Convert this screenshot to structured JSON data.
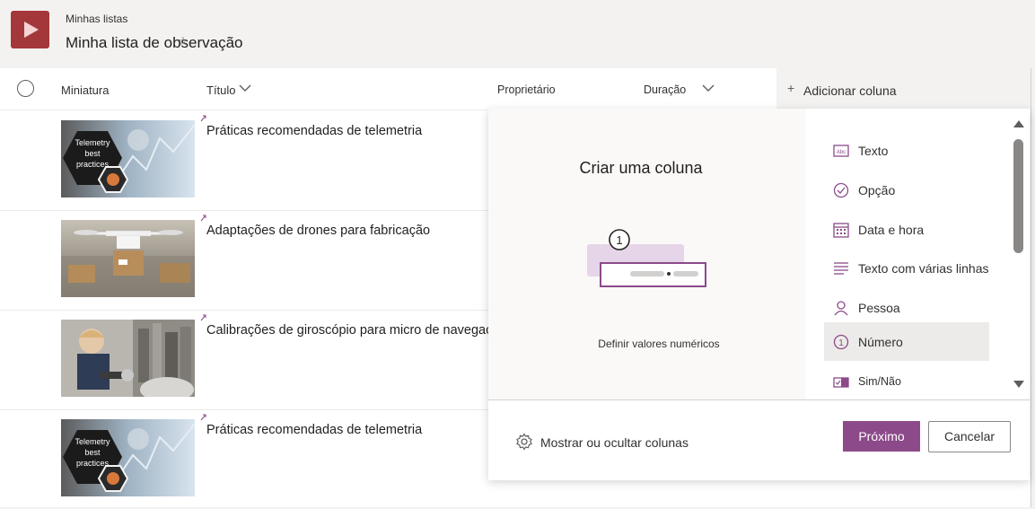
{
  "header": {
    "app_icon": "play-icon",
    "breadcrumb": "Minhas listas",
    "title": "Minha lista de observação",
    "favorite_icon": "star-icon"
  },
  "columns": {
    "thumbnail": "Miniatura",
    "title": "Título",
    "owner": "Proprietário",
    "duration": "Duração",
    "add_column": "Adicionar coluna"
  },
  "rows": [
    {
      "title": "Práticas recomendadas de telemetria",
      "thumbnail": "telemetry",
      "thumb_text": [
        "Telemetry",
        "best",
        "practices"
      ]
    },
    {
      "title": "Adaptações de drones para fabricação",
      "thumbnail": "drone"
    },
    {
      "title": "Calibrações de giroscópio para micro de navegação urbana",
      "thumbnail": "gyroscope"
    },
    {
      "title": "Práticas recomendadas de telemetria",
      "thumbnail": "telemetry",
      "thumb_text": [
        "Telemetry",
        "best",
        "practices"
      ]
    }
  ],
  "create_column_panel": {
    "heading": "Criar uma coluna",
    "description": "Definir valores numéricos",
    "illustration_number": "1",
    "types": [
      {
        "label": "Texto",
        "icon": "text-icon",
        "selected": false
      },
      {
        "label": "Opção",
        "icon": "choice-icon",
        "selected": false
      },
      {
        "label": "Data e hora",
        "icon": "calendar-icon",
        "selected": false
      },
      {
        "label": "Texto com várias linhas",
        "icon": "multiline-text-icon",
        "selected": false
      },
      {
        "label": "Pessoa",
        "icon": "person-icon",
        "selected": false
      },
      {
        "label": "Número",
        "icon": "number-icon",
        "selected": true
      },
      {
        "label": "Sim/Não",
        "icon": "yes-no-icon",
        "selected": false
      }
    ],
    "show_hide_columns": "Mostrar ou ocultar colunas",
    "next_button": "Próximo",
    "cancel_button": "Cancelar"
  },
  "colors": {
    "accent": "#8c4a8a",
    "app_icon_bg": "#a4373a",
    "icon_purple": "#8c4a8a"
  }
}
